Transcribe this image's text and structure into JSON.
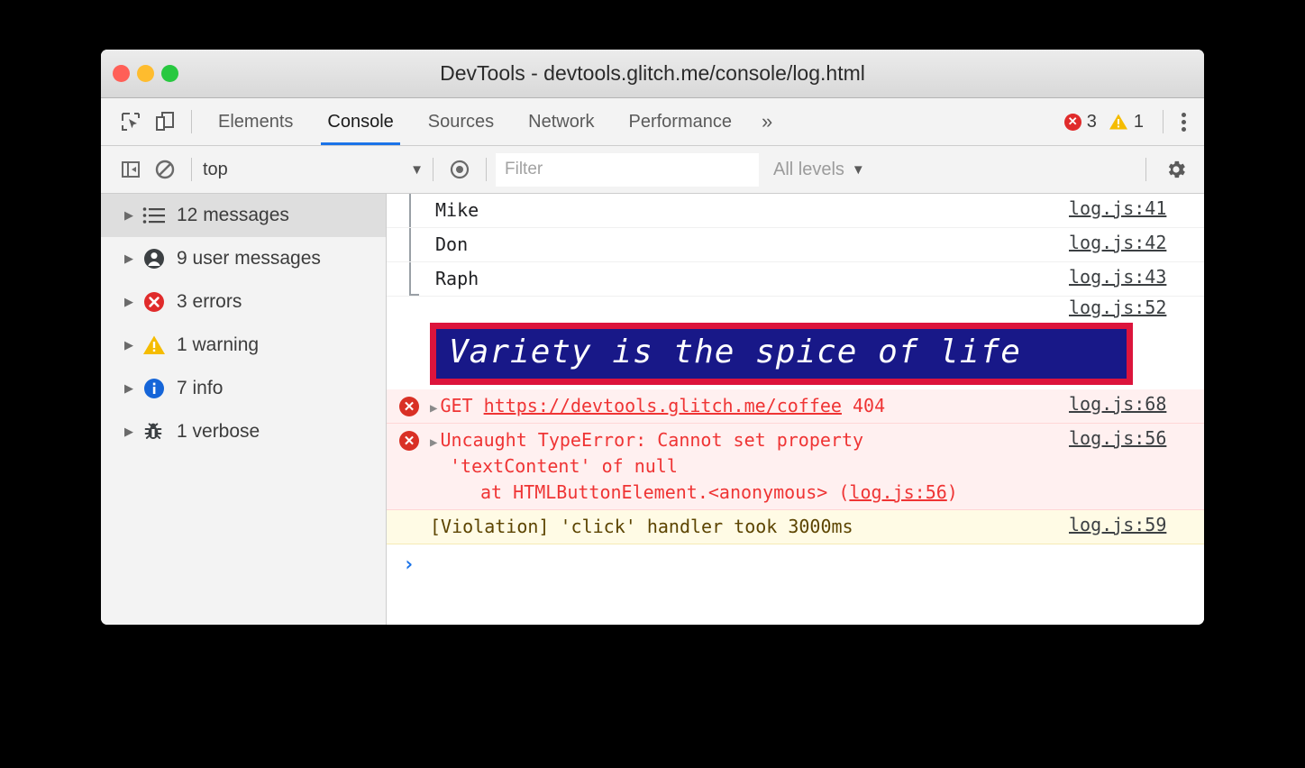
{
  "window": {
    "title": "DevTools - devtools.glitch.me/console/log.html",
    "traffic_lights": [
      "close",
      "minimize",
      "zoom"
    ]
  },
  "tabbar": {
    "inspect_icon": "inspect-element-icon",
    "device_icon": "device-toolbar-icon",
    "tabs": [
      {
        "label": "Elements",
        "active": false
      },
      {
        "label": "Console",
        "active": true
      },
      {
        "label": "Sources",
        "active": false
      },
      {
        "label": "Network",
        "active": false
      },
      {
        "label": "Performance",
        "active": false
      }
    ],
    "more_tabs": "»",
    "error_count": "3",
    "warning_count": "1",
    "menu_icon": "kebab-menu-icon"
  },
  "filterbar": {
    "sidebar_toggle_icon": "show-console-sidebar-icon",
    "clear_icon": "clear-console-icon",
    "context": "top",
    "context_caret": "▼",
    "eye_icon": "create-live-expression-icon",
    "filter_placeholder": "Filter",
    "filter_value": "",
    "levels": "All levels",
    "levels_caret": "▼",
    "settings_icon": "settings-gear-icon"
  },
  "sidebar": {
    "items": [
      {
        "label": "12 messages",
        "icon": "list-icon",
        "selected": true
      },
      {
        "label": "9 user messages",
        "icon": "user-icon",
        "selected": false
      },
      {
        "label": "3 errors",
        "icon": "error-icon",
        "selected": false
      },
      {
        "label": "1 warning",
        "icon": "warning-icon",
        "selected": false
      },
      {
        "label": "7 info",
        "icon": "info-icon",
        "selected": false
      },
      {
        "label": "1 verbose",
        "icon": "bug-icon",
        "selected": false
      }
    ],
    "arrow": "▶"
  },
  "console": {
    "group_rows": [
      {
        "text": "Mike",
        "source": "log.js:41"
      },
      {
        "text": "Don",
        "source": "log.js:42"
      },
      {
        "text": "Raph",
        "source": "log.js:43"
      }
    ],
    "banner": {
      "text": "Variety is the spice of life",
      "source": "log.js:52",
      "border_color": "#DC143C",
      "background_color": "#181888",
      "text_color": "#ffffff"
    },
    "errors": [
      {
        "triangle": "▶",
        "prefix": "GET ",
        "link": "https://devtools.glitch.me/coffee",
        "suffix": " 404",
        "source": "log.js:68"
      }
    ],
    "exception": {
      "triangle": "▶",
      "line1": "Uncaught TypeError: Cannot set property",
      "line2": "'textContent' of null",
      "line3_prefix": "at HTMLButtonElement.<anonymous> (",
      "line3_link": "log.js:56",
      "line3_suffix": ")",
      "source": "log.js:56"
    },
    "violation": {
      "text": "[Violation] 'click' handler took 3000ms",
      "source": "log.js:59"
    },
    "prompt_chevron": "›"
  }
}
